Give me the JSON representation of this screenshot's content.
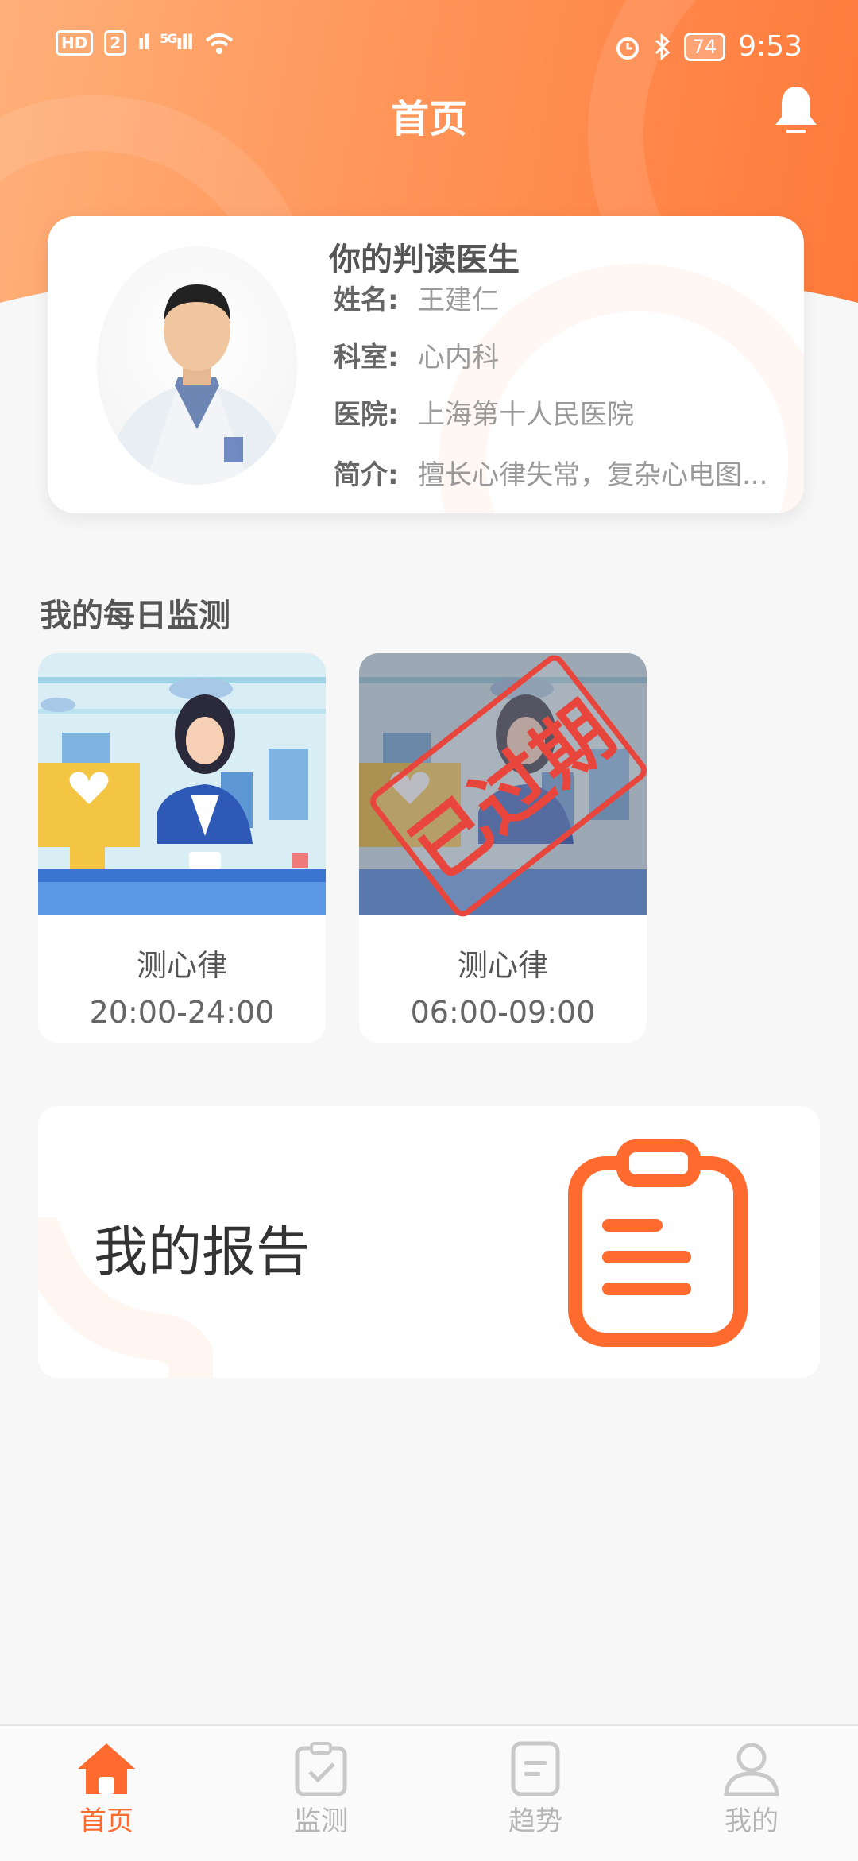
{
  "status_bar": {
    "hd": "HD",
    "sim": "2",
    "signal1": "⁴ᴳ",
    "signal2": "5G",
    "battery": "74",
    "time": "9:53"
  },
  "header": {
    "title": "首页"
  },
  "doctor": {
    "heading": "你的判读医生",
    "name_label": "姓名:",
    "name": "王建仁",
    "dept_label": "科室:",
    "dept": "心内科",
    "hospital_label": "医院:",
    "hospital": "上海第十人民医院",
    "intro_label": "简介:",
    "intro": "擅长心律失常，复杂心电图..."
  },
  "monitoring": {
    "title": "我的每日监测",
    "tasks": [
      {
        "name": "测心律",
        "time": "20:00-24:00",
        "expired": false
      },
      {
        "name": "测心律",
        "time": "06:00-09:00",
        "expired": true,
        "stamp": "已过期"
      }
    ]
  },
  "report": {
    "label": "我的报告"
  },
  "tabs": [
    {
      "label": "首页",
      "icon": "home-icon",
      "active": true
    },
    {
      "label": "监测",
      "icon": "clipboard-check-icon",
      "active": false
    },
    {
      "label": "趋势",
      "icon": "trend-doc-icon",
      "active": false
    },
    {
      "label": "我的",
      "icon": "user-icon",
      "active": false
    }
  ],
  "colors": {
    "accent": "#ff6a2f",
    "header_light": "#ffb07a",
    "stamp": "#e8453c"
  }
}
